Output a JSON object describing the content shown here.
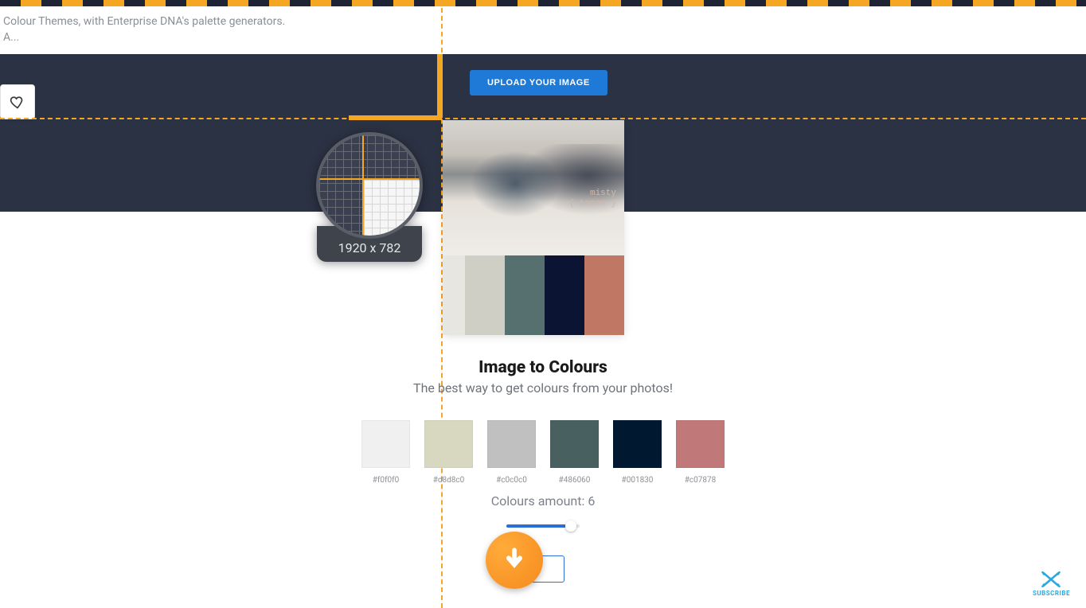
{
  "header": {
    "desc_line1": "Colour Themes, with Enterprise DNA's palette generators.",
    "desc_line2": "A..."
  },
  "upload_button_label": "UPLOAD YOUR IMAGE",
  "inspector": {
    "dimensions": "1920 x 782"
  },
  "preview": {
    "tag_line1": "misty",
    "tag_line2": "{ tones }",
    "palette_strip": [
      "#e8e6e1",
      "#cfcfc6",
      "#56706f",
      "#0c1433",
      "#c07763"
    ]
  },
  "main": {
    "title": "Image to Colours",
    "subtitle": "The best way to get colours from your photos!"
  },
  "swatches": [
    {
      "hex": "#f0f0f0",
      "label": "#f0f0f0"
    },
    {
      "hex": "#d8d8c0",
      "label": "#d8d8c0"
    },
    {
      "hex": "#c0c0c0",
      "label": "#c0c0c0"
    },
    {
      "hex": "#486060",
      "label": "#486060"
    },
    {
      "hex": "#001830",
      "label": "#001830"
    },
    {
      "hex": "#c07878",
      "label": "#c07878"
    }
  ],
  "amount": {
    "label_prefix": "Colours amount: ",
    "value": "6"
  },
  "subscribe_label": "SUBSCRIBE"
}
